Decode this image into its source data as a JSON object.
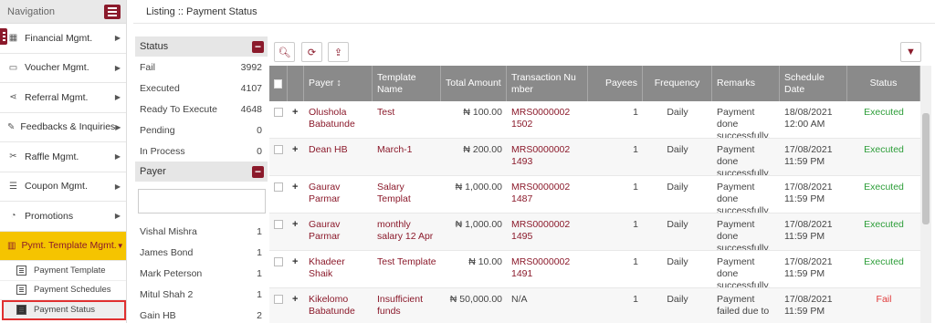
{
  "sidebar": {
    "title": "Navigation",
    "items": [
      {
        "label": "Financial Mgmt."
      },
      {
        "label": "Voucher Mgmt."
      },
      {
        "label": "Referral Mgmt."
      },
      {
        "label": "Feedbacks & Inquiries"
      },
      {
        "label": "Raffle Mgmt."
      },
      {
        "label": "Coupon Mgmt."
      },
      {
        "label": "Promotions"
      },
      {
        "label": "Pymt. Template Mgmt."
      }
    ],
    "subitems": [
      {
        "label": "Payment Template"
      },
      {
        "label": "Payment Schedules"
      },
      {
        "label": "Payment Status"
      }
    ]
  },
  "page": {
    "title": "Listing :: Payment Status"
  },
  "filters": {
    "status_title": "Status",
    "status": [
      {
        "label": "Fail",
        "count": "3992"
      },
      {
        "label": "Executed",
        "count": "4107"
      },
      {
        "label": "Ready To Execute",
        "count": "4648"
      },
      {
        "label": "Pending",
        "count": "0"
      },
      {
        "label": "In Process",
        "count": "0"
      }
    ],
    "payer_title": "Payer",
    "payers": [
      {
        "label": "Vishal Mishra",
        "count": "1"
      },
      {
        "label": "James Bond",
        "count": "1"
      },
      {
        "label": "Mark Peterson",
        "count": "1"
      },
      {
        "label": "Mitul Shah 2",
        "count": "1"
      },
      {
        "label": "Gain HB",
        "count": "2"
      }
    ]
  },
  "table": {
    "headers": [
      "Payer",
      "Template Name",
      "Total Amount",
      "Transaction Number",
      "Payees",
      "Frequency",
      "Remarks",
      "Schedule Date",
      "Status"
    ],
    "header_lines": {
      "payer": "Payer ↕",
      "txn1": "Transaction Nu",
      "txn2": "mber"
    },
    "rows": [
      {
        "payer": "Olushola Babatunde",
        "template": "Test",
        "amount": "₦ 100.00",
        "txn": "MRS0000002 1502",
        "payees": "1",
        "frequency": "Daily",
        "remarks": "Payment done successfully.",
        "date": "18/08/2021 12:00 AM",
        "status": "Executed"
      },
      {
        "payer": "Dean HB",
        "template": "March-1",
        "amount": "₦ 200.00",
        "txn": "MRS0000002 1493",
        "payees": "1",
        "frequency": "Daily",
        "remarks": "Payment done successfully.",
        "date": "17/08/2021 11:59 PM",
        "status": "Executed"
      },
      {
        "payer": "Gaurav Parmar",
        "template": "Salary Templat",
        "amount": "₦ 1,000.00",
        "txn": "MRS0000002 1487",
        "payees": "1",
        "frequency": "Daily",
        "remarks": "Payment done successfully.",
        "date": "17/08/2021 11:59 PM",
        "status": "Executed"
      },
      {
        "payer": "Gaurav Parmar",
        "template": "monthly salary 12 Apr",
        "amount": "₦ 1,000.00",
        "txn": "MRS0000002 1495",
        "payees": "1",
        "frequency": "Daily",
        "remarks": "Payment done successfully.",
        "date": "17/08/2021 11:59 PM",
        "status": "Executed"
      },
      {
        "payer": "Khadeer Shaik",
        "template": "Test Template",
        "amount": "₦ 10.00",
        "txn": "MRS0000002 1491",
        "payees": "1",
        "frequency": "Daily",
        "remarks": "Payment done successfully.",
        "date": "17/08/2021 11:59 PM",
        "status": "Executed"
      },
      {
        "payer": "Kikelomo Babatunde",
        "template": "Insufficient funds",
        "amount": "₦ 50,000.00",
        "txn": "N/A",
        "payees": "1",
        "frequency": "Daily",
        "remarks": "Payment failed due to",
        "date": "17/08/2021 11:59 PM",
        "status": "Fail"
      }
    ]
  },
  "colors": {
    "brand": "#8b1a2b",
    "accent": "#f5c400",
    "success": "#2e9e3a",
    "fail": "#e03a3a"
  }
}
